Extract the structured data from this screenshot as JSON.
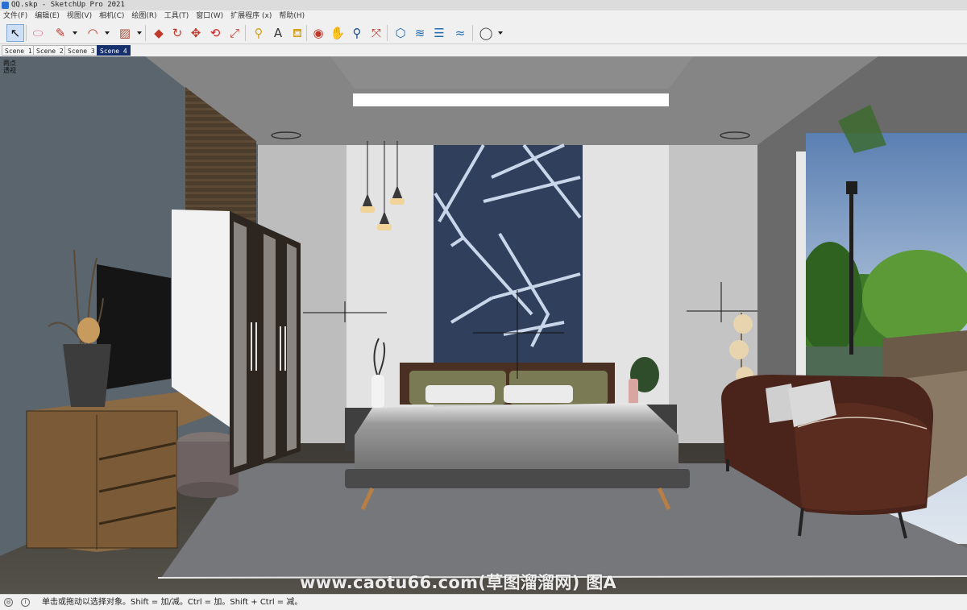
{
  "window": {
    "title": "QQ.skp - SketchUp Pro 2021"
  },
  "menu": [
    "文件(F)",
    "编辑(E)",
    "视图(V)",
    "相机(C)",
    "绘图(R)",
    "工具(T)",
    "窗口(W)",
    "扩展程序 (x)",
    "帮助(H)"
  ],
  "toolbar": {
    "tools": [
      {
        "name": "select-tool",
        "glyph": "↖",
        "color": "#111111",
        "active": true
      },
      {
        "name": "eraser-tool",
        "glyph": "⬭",
        "color": "#e86a9b"
      },
      {
        "name": "line-tool",
        "glyph": "✎",
        "color": "#c0392b"
      },
      {
        "name": "arc-tool",
        "glyph": "◠",
        "color": "#c0392b"
      },
      {
        "name": "rectangle-tool",
        "glyph": "▨",
        "color": "#a84b3a"
      },
      {
        "name": "push-pull-tool",
        "glyph": "◆",
        "color": "#c0392b"
      },
      {
        "name": "follow-me-tool",
        "glyph": "↻",
        "color": "#c0392b"
      },
      {
        "name": "move-tool",
        "glyph": "✥",
        "color": "#c0392b"
      },
      {
        "name": "rotate-tool",
        "glyph": "⟲",
        "color": "#d42020"
      },
      {
        "name": "scale-tool",
        "glyph": "⤢",
        "color": "#c0392b"
      },
      {
        "name": "tape-measure-tool",
        "glyph": "⚲",
        "color": "#d4a017"
      },
      {
        "name": "text-tool",
        "glyph": "A",
        "color": "#333333"
      },
      {
        "name": "paint-bucket-tool",
        "glyph": "⛾",
        "color": "#d4a017"
      },
      {
        "name": "orbit-tool",
        "glyph": "◉",
        "color": "#c0392b"
      },
      {
        "name": "pan-tool",
        "glyph": "✋",
        "color": "#d4a017"
      },
      {
        "name": "zoom-tool",
        "glyph": "⚲",
        "color": "#1f4d99"
      },
      {
        "name": "zoom-extents-tool",
        "glyph": "⤧",
        "color": "#c0392b"
      },
      {
        "name": "3d-warehouse-tool",
        "glyph": "⬡",
        "color": "#1f6bb3"
      },
      {
        "name": "extension-warehouse-tool",
        "glyph": "≋",
        "color": "#1f6bb3"
      },
      {
        "name": "layout-tool",
        "glyph": "☰",
        "color": "#1f6bb3"
      },
      {
        "name": "style-builder-tool",
        "glyph": "≈",
        "color": "#1f6bb3"
      },
      {
        "name": "account-tool",
        "glyph": "◯",
        "color": "#444444"
      }
    ]
  },
  "scenes": [
    {
      "label": "Scene 1",
      "selected": false
    },
    {
      "label": "Scene 2",
      "selected": false
    },
    {
      "label": "Scene 3",
      "selected": false
    },
    {
      "label": "Scene 4",
      "selected": true
    }
  ],
  "viewport": {
    "label": "两点透视",
    "watermark": "www.caotu66.com(草图溜溜网) 图A"
  },
  "status": {
    "text": "单击或拖动以选择对象。Shift = 加/减。Ctrl = 加。Shift + Ctrl = 减。",
    "icons": [
      "geo-location-icon",
      "info-icon"
    ]
  }
}
